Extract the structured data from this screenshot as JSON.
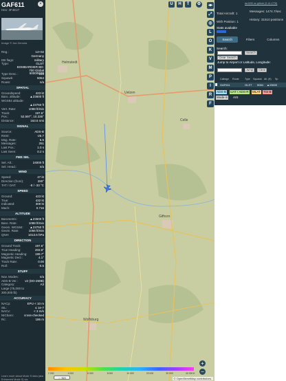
{
  "aircraft": {
    "callsign": "GAF611",
    "hex_label": "Hex: 3F4E27",
    "photo_credit": "Image © Jan Zemola"
  },
  "info_rows": [
    {
      "k": "Reg.:",
      "v": "14+02"
    },
    {
      "k": "",
      "v": "Germany"
    },
    {
      "k": "DB flags:",
      "v": "military"
    },
    {
      "k": "Type:",
      "v": "GLST"
    },
    {
      "k": "",
      "v": "BOMBARDIER BD-700 Global 5000/5500"
    },
    {
      "k": "Type Desc.:",
      "v": "L2J"
    },
    {
      "k": "Squawk:",
      "v": "5064"
    },
    {
      "k": "Route:",
      "v": "n/a"
    }
  ],
  "sections": {
    "spatial": "SPATIAL",
    "signal": "SIGNAL",
    "fms": "FMS SEL",
    "wind": "WIND",
    "speed": "SPEED",
    "altitude": "ALTITUDE",
    "direction": "DIRECTION",
    "stuff": "STUFF",
    "accuracy": "ACCURACY"
  },
  "spatial_rows": [
    {
      "k": "Groundspeed:",
      "v": "423 kt"
    },
    {
      "k": "Baro. altitude:",
      "v": "▲23600 ft"
    },
    {
      "k": "WGS84 altitude:",
      "v": ""
    },
    {
      "k": "",
      "v": "▲23750 ft"
    },
    {
      "k": "Vert. Rate:",
      "v": "1088 ft/min"
    },
    {
      "k": "Track:",
      "v": "197.6°"
    },
    {
      "k": "Pos.:",
      "v": "52.597°, 10.336°"
    },
    {
      "k": "Distance:",
      "v": "163.5 nmi"
    }
  ],
  "signal_rows": [
    {
      "k": "Source:",
      "v": "ADS-B"
    },
    {
      "k": "RSSI:",
      "v": "-25.7"
    },
    {
      "k": "Msg. Rate:",
      "v": "6.5"
    },
    {
      "k": "Messages:",
      "v": "251"
    },
    {
      "k": "Last Pos.:",
      "v": "1.0 s"
    },
    {
      "k": "Last Seen:",
      "v": "0.2 s"
    }
  ],
  "fms_rows": [
    {
      "k": "Sel. Alt.:",
      "v": "24000 ft"
    },
    {
      "k": "Sel. Head.:",
      "v": "n/a"
    }
  ],
  "wind_rows": [
    {
      "k": "Speed:",
      "v": "47 kt"
    },
    {
      "k": "Direction (from):",
      "v": "280°"
    },
    {
      "k": "TAT / OAT:",
      "v": "-8 / -33 °C"
    }
  ],
  "speed_rows": [
    {
      "k": "Ground:",
      "v": "423 kt"
    },
    {
      "k": "True:",
      "v": "432 kt"
    },
    {
      "k": "Indicated:",
      "v": "309 kt"
    },
    {
      "k": "Mach:",
      "v": "0.716"
    }
  ],
  "altitude_rows": [
    {
      "k": "Barometric:",
      "v": "▲23600 ft"
    },
    {
      "k": "Baro. Rate:",
      "v": "1088 ft/min"
    },
    {
      "k": "Geom. WGS84:",
      "v": "▲23750 ft"
    },
    {
      "k": "Geom. Rate:",
      "v": "1056 ft/min"
    },
    {
      "k": "QNH:",
      "v": "1013.6 hPa"
    }
  ],
  "direction_rows": [
    {
      "k": "Ground Track:",
      "v": "197.6°"
    },
    {
      "k": "True Heading:",
      "v": "203.8°"
    },
    {
      "k": "Magnetic Heading:",
      "v": "199.7°"
    },
    {
      "k": "Magnetic Decl.:",
      "v": "4.1°"
    },
    {
      "k": "Track Rate:",
      "v": "0.00"
    },
    {
      "k": "Roll:",
      "v": "-0.5"
    }
  ],
  "stuff_rows": [
    {
      "k": "Nav. Modes:",
      "v": "n/a"
    },
    {
      "k": "ADS-B Ver.:",
      "v": "v2 (DO-260B)"
    },
    {
      "k": "Category:",
      "v": "A3"
    },
    {
      "k": "Large (75,000 to",
      "v": ""
    },
    {
      "k": "300,000 lb)",
      "v": ""
    }
  ],
  "accuracy_rows": [
    {
      "k": "NACp:",
      "v": "EPU < 10 m"
    },
    {
      "k": "SIL:",
      "v": "≤ 1e-7"
    },
    {
      "k": "NACv:",
      "v": "< 3 m/s"
    },
    {
      "k": "NICbaro:",
      "v": "cross-checked"
    },
    {
      "k": "Rc:",
      "v": "186 m"
    }
  ],
  "left_footer": "Learn more about Mode S data (aka Enhanced Mode S) via",
  "map": {
    "top_buttons": [
      "U",
      "H",
      "T"
    ],
    "side_buttons": [
      "L",
      "O",
      "K",
      "V",
      "M",
      "P",
      "I",
      "R",
      "F"
    ],
    "place_labels": [
      "Helmstedt",
      "Uelzen",
      "Gifhorn",
      "Wolfsburg",
      "Celle"
    ],
    "colorbar_labels": [
      "2 000",
      "4 000",
      "6 000",
      "8 000",
      "10 000",
      "20 000",
      "30 000",
      "40 000 ft"
    ],
    "attribution": "© OpenStreetMap contributors.",
    "units_button": "⇔ NM",
    "zoom_in": "+",
    "zoom_out": "−"
  },
  "sidebar": {
    "version": "tar1090 on github (3.14.1778)",
    "total_aircraft": "Total Aircraft: 1",
    "messages": "Messages: 1474.7/sec",
    "with_position": "With Position: 1",
    "history": "History: 31510 positions",
    "stats_available": "Stats available",
    "tabs": [
      "Search",
      "Filters",
      "Columns"
    ],
    "search_label": "Search:",
    "search_button": "Search",
    "clear_search_button": "Clear Search",
    "jump_label": "Jump to Airport or Latitude, Longitude:",
    "jump_button": "Jump",
    "clear_button": "Clear",
    "list_headers": [
      "",
      "Callsign",
      "Route",
      "Type",
      "Squawk",
      "Alt. (ft)",
      "Sp"
    ],
    "row": {
      "callsign": "GAF611",
      "type": "GLST",
      "squawk": "5064",
      "alt": "▲23600"
    },
    "badges": [
      {
        "label": "ADS-B",
        "color": "#9ee3ff"
      },
      {
        "label": "UAT / ADS-R",
        "color": "#b8e986"
      },
      {
        "label": "MLAT",
        "color": "#ffd27f"
      },
      {
        "label": "TIS-B",
        "color": "#ff9a9a"
      },
      {
        "label": "Mode-S",
        "color": "#d8d8d8"
      },
      {
        "label": "AIS",
        "color": "#ffffff"
      }
    ]
  },
  "colors": {
    "panel_bg": "#1d2b32",
    "section_bg": "#243842",
    "map_bg": "#c9cfa3",
    "aircraft_marker": "#3c7cff"
  }
}
